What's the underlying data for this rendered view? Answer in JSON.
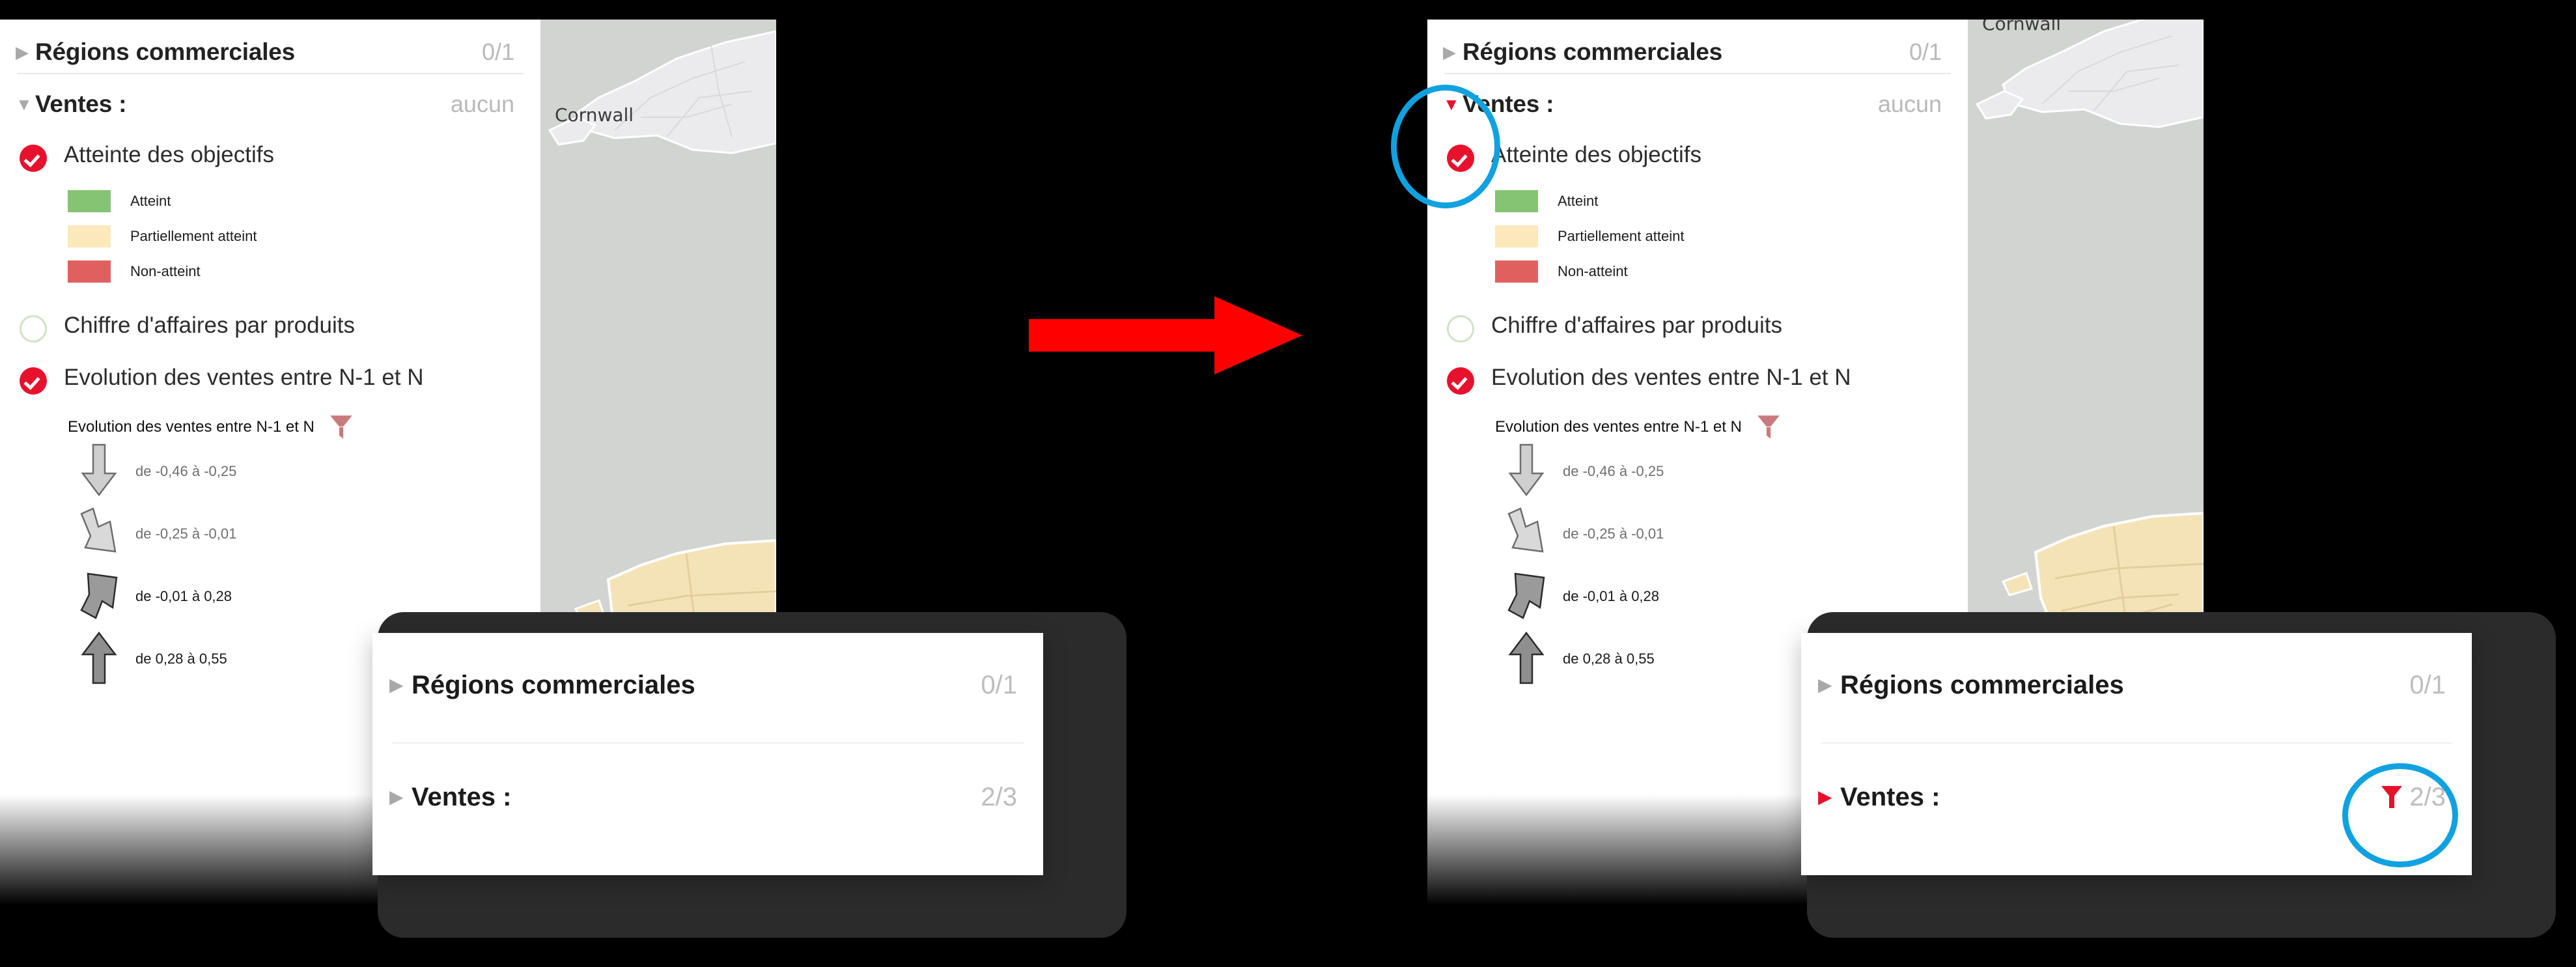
{
  "colors": {
    "accent_red": "#e8112d",
    "annotation_blue": "#10a2e0",
    "arrow_red": "#ff0000",
    "swatch_green": "#85c472",
    "swatch_cream": "#fbe9bb",
    "swatch_red": "#e06060",
    "funnel_muted": "#c97b7b",
    "map_sea": "#d2d4d1",
    "map_land_uk": "#ebebee",
    "map_land_fr": "#f5e3b8"
  },
  "panels": [
    {
      "id": "before",
      "tree": [
        {
          "label": "Régions commerciales",
          "count": "0/1",
          "caret": "collapsed",
          "caret_color": "grey"
        },
        {
          "label": "Ventes :",
          "count": "aucun",
          "caret": "expanded",
          "caret_color": "grey"
        }
      ],
      "layers": [
        {
          "label": "Atteinte des objectifs",
          "state": "checked"
        },
        {
          "label": "Chiffre d'affaires par produits",
          "state": "unchecked"
        },
        {
          "label": "Evolution des ventes entre N-1 et N",
          "state": "checked"
        }
      ],
      "swatches": [
        {
          "label": "Atteint",
          "color": "#85c472"
        },
        {
          "label": "Partiellement atteint",
          "color": "#fbe9bb"
        },
        {
          "label": "Non-atteint",
          "color": "#e06060"
        }
      ],
      "arrow_legend": {
        "title": "Evolution des ventes entre N-1 et N",
        "filter_icon": "funnel-icon",
        "items": [
          {
            "direction": "down",
            "range": "de -0,46 à -0,25",
            "fill": "#cfcfcf",
            "emphasis": "light"
          },
          {
            "direction": "down-right",
            "range": "de -0,25 à -0,01",
            "fill": "#d9d9d9",
            "emphasis": "light"
          },
          {
            "direction": "up-right",
            "range": "de -0,01 à 0,28",
            "fill": "#9a9a9a",
            "emphasis": "dark"
          },
          {
            "direction": "up",
            "range": "de 0,28 à 0,55",
            "fill": "#8f8f8f",
            "emphasis": "dark"
          }
        ]
      },
      "map": {
        "label": "Cornwall"
      },
      "card": {
        "rows": [
          {
            "label": "Régions commerciales",
            "count": "0/1",
            "caret": "collapsed",
            "caret_color": "grey",
            "filter": false
          },
          {
            "label": "Ventes :",
            "count": "2/3",
            "caret": "collapsed",
            "caret_color": "grey",
            "filter": false
          }
        ]
      }
    },
    {
      "id": "after",
      "tree": [
        {
          "label": "Régions commerciales",
          "count": "0/1",
          "caret": "collapsed",
          "caret_color": "grey"
        },
        {
          "label": "Ventes :",
          "count": "aucun",
          "caret": "expanded",
          "caret_color": "red"
        }
      ],
      "layers": [
        {
          "label": "Atteinte des objectifs",
          "state": "checked"
        },
        {
          "label": "Chiffre d'affaires par produits",
          "state": "unchecked"
        },
        {
          "label": "Evolution des ventes entre N-1 et N",
          "state": "checked"
        }
      ],
      "swatches": [
        {
          "label": "Atteint",
          "color": "#85c472"
        },
        {
          "label": "Partiellement atteint",
          "color": "#fbe9bb"
        },
        {
          "label": "Non-atteint",
          "color": "#e06060"
        }
      ],
      "arrow_legend": {
        "title": "Evolution des ventes entre N-1 et N",
        "filter_icon": "funnel-icon",
        "items": [
          {
            "direction": "down",
            "range": "de -0,46 à -0,25",
            "fill": "#cfcfcf",
            "emphasis": "light"
          },
          {
            "direction": "down-right",
            "range": "de -0,25 à -0,01",
            "fill": "#d9d9d9",
            "emphasis": "light"
          },
          {
            "direction": "up-right",
            "range": "de -0,01 à 0,28",
            "fill": "#9a9a9a",
            "emphasis": "dark"
          },
          {
            "direction": "up",
            "range": "de 0,28 à 0,55",
            "fill": "#8f8f8f",
            "emphasis": "dark"
          }
        ]
      },
      "map": {
        "label": "Cornwall"
      },
      "card": {
        "rows": [
          {
            "label": "Régions commerciales",
            "count": "0/1",
            "caret": "collapsed",
            "caret_color": "grey",
            "filter": false
          },
          {
            "label": "Ventes :",
            "count": "2/3",
            "caret": "collapsed",
            "caret_color": "red",
            "filter": true
          }
        ]
      }
    }
  ],
  "annotations": {
    "transition_arrow": "red-right-arrow",
    "highlight_caret": "blue-ellipse-around-ventes-caret",
    "highlight_filter": "blue-ellipse-around-filter-icon"
  }
}
